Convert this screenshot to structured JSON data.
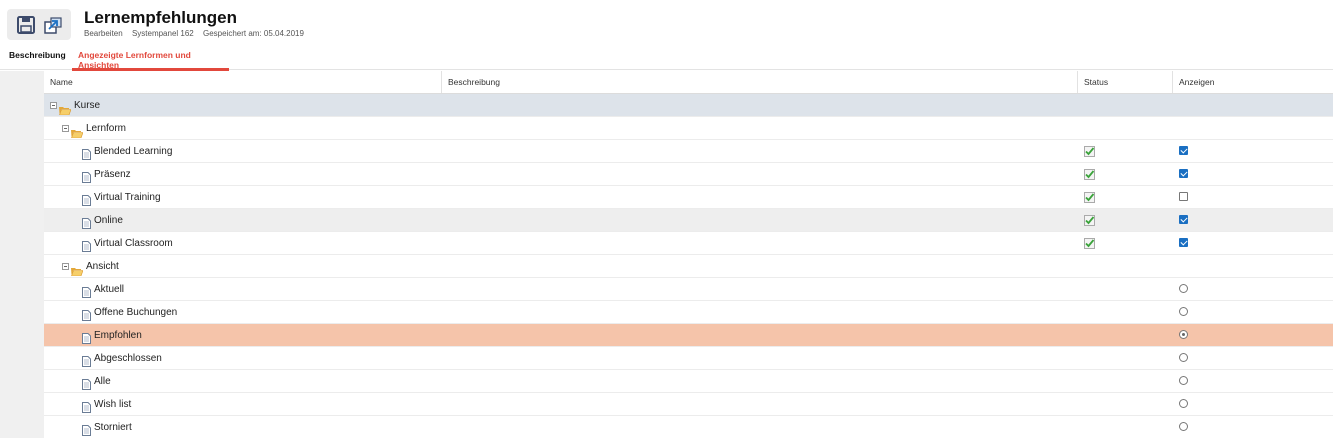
{
  "header": {
    "title": "Lernempfehlungen",
    "meta": [
      "Bearbeiten",
      "Systempanel 162",
      "Gespeichert am: 05.04.2019"
    ],
    "icons": [
      "save-icon",
      "export-icon"
    ]
  },
  "tabs": [
    {
      "label": "Beschreibung",
      "active": false
    },
    {
      "label": "Angezeigte Lernformen und Ansichten",
      "active": true
    }
  ],
  "table": {
    "columns": [
      "Name",
      "Beschreibung",
      "Status",
      "Anzeigen"
    ],
    "rows": [
      {
        "label": "Kurse",
        "level": 0,
        "type": "folder",
        "status": null,
        "show": null,
        "style": "group"
      },
      {
        "label": "Lernform",
        "level": 1,
        "type": "folder",
        "status": null,
        "show": null,
        "style": ""
      },
      {
        "label": "Blended Learning",
        "level": 2,
        "type": "doc",
        "status": true,
        "show": "checked",
        "style": ""
      },
      {
        "label": "Präsenz",
        "level": 2,
        "type": "doc",
        "status": true,
        "show": "checked",
        "style": ""
      },
      {
        "label": "Virtual Training",
        "level": 2,
        "type": "doc",
        "status": true,
        "show": "unchecked",
        "style": ""
      },
      {
        "label": "Online",
        "level": 2,
        "type": "doc",
        "status": true,
        "show": "checked",
        "style": "alt"
      },
      {
        "label": "Virtual Classroom",
        "level": 2,
        "type": "doc",
        "status": true,
        "show": "checked",
        "style": ""
      },
      {
        "label": "Ansicht",
        "level": 1,
        "type": "folder",
        "status": null,
        "show": null,
        "style": ""
      },
      {
        "label": "Aktuell",
        "level": 2,
        "type": "doc",
        "status": null,
        "show": "radio",
        "style": ""
      },
      {
        "label": "Offene Buchungen",
        "level": 2,
        "type": "doc",
        "status": null,
        "show": "radio",
        "style": ""
      },
      {
        "label": "Empfohlen",
        "level": 2,
        "type": "doc",
        "status": null,
        "show": "radio-on",
        "style": "sel"
      },
      {
        "label": "Abgeschlossen",
        "level": 2,
        "type": "doc",
        "status": null,
        "show": "radio",
        "style": ""
      },
      {
        "label": "Alle",
        "level": 2,
        "type": "doc",
        "status": null,
        "show": "radio",
        "style": ""
      },
      {
        "label": "Wish list",
        "level": 2,
        "type": "doc",
        "status": null,
        "show": "radio",
        "style": ""
      },
      {
        "label": "Storniert",
        "level": 2,
        "type": "doc",
        "status": null,
        "show": "radio",
        "style": ""
      }
    ]
  },
  "colors": {
    "accent": "#e2483c",
    "checkbox": "#1a6fc2",
    "selected_row": "#f5c4aa",
    "group_row": "#dde3ea"
  }
}
